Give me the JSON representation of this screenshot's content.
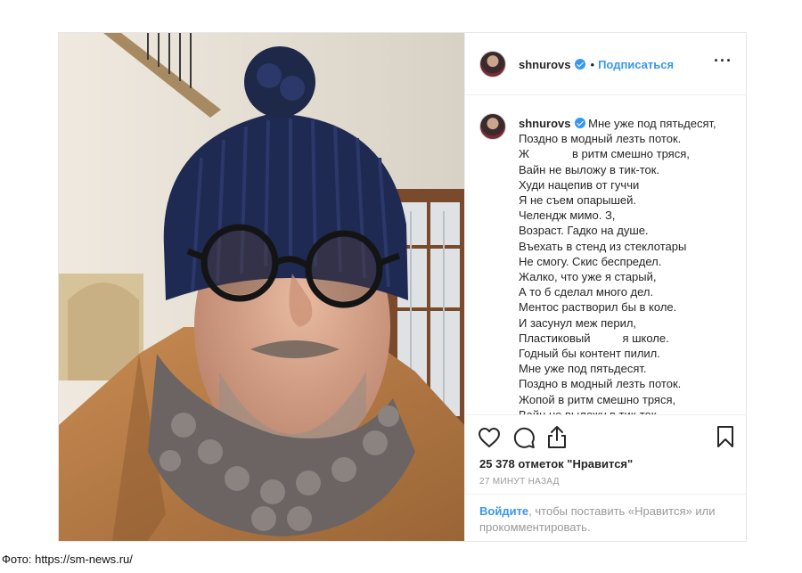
{
  "post": {
    "username": "shnurovs",
    "follow_label": "Подписаться",
    "separator": "•",
    "more_label": "···",
    "caption_lines": [
      "Мне уже под пятьдесят,",
      "Поздно в модный лезть поток.",
      "в ритм смешно тряся,",
      "Вайн не выложу в тик-ток.",
      "Худи нацепив от гуччи",
      "Я не съем опарышей.",
      "Челендж мимо. З",
      "Возраст. Гадко на душе.",
      "Въехать в стенд из стеклотары",
      "Не смогу. Скис беспредел.",
      "Жалко, что уже я старый,",
      "А то б сделал много дел.",
      "Ментос растворил бы в коле.",
      "И засунул меж перил,",
      "Пластиковый",
      "я школе.",
      "Годный бы контент пилил.",
      "Мне уже под пятьдесят.",
      "Поздно в модный лезть поток.",
      "Жопой в ритм смешно тряся,",
      "Вайн не выложу в тик-ток."
    ],
    "caption_prefix_zh": "Ж",
    "caption_suffix_3": ",",
    "likes": "25 378 отметок \"Нравится\"",
    "time": "27 минут назад",
    "login_link": "Войдите",
    "login_text": ", чтобы поставить «Нравится» или прокомментировать."
  },
  "icons": {
    "like": "heart-icon",
    "comment": "comment-icon",
    "share": "share-icon",
    "save": "bookmark-icon",
    "verified": "verified-badge-icon"
  },
  "colors": {
    "accent": "#3897f0",
    "text": "#262626",
    "muted": "#999999",
    "border": "#efefef"
  },
  "credit": "Фото: https://sm-news.ru/"
}
